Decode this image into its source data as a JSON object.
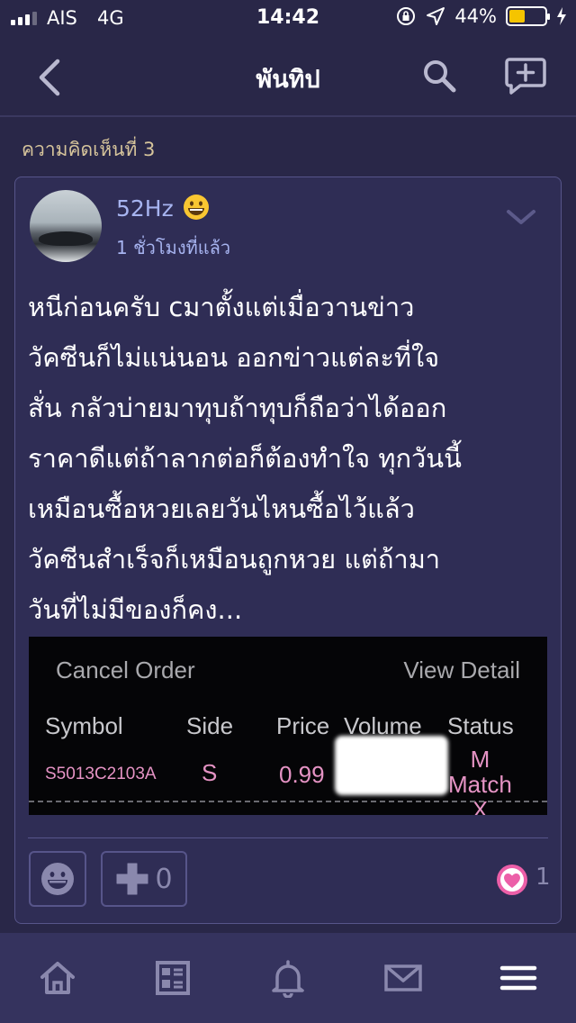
{
  "status_bar": {
    "carrier": "AIS",
    "network": "4G",
    "time": "14:42",
    "battery_percent": "44%",
    "battery_level": 0.44
  },
  "nav": {
    "title": "พันทิป",
    "icons": [
      "back-icon",
      "search-icon",
      "compose-icon"
    ]
  },
  "comment": {
    "number_label": "ความคิดเห็นที่ 3",
    "author": "52Hz",
    "time_ago": "1 ชั่วโมงที่แล้ว",
    "text": "หนีก่อนครับ cมาตั้งแต่เมื่อวานข่าว\nวัคซีนก็ไม่แน่นอน ออกข่าวแต่ละที่ใจ\nสั่น กลัวบ่ายมาทุบถ้าทุบก็ถือว่าได้ออก\nราคาดีแต่ถ้าลากต่อก็ต้องทำใจ ทุกวันนี้\nเหมือนซื้อหวยเลยวันไหนซื้อไว้แล้ว\nวัคซีนสำเร็จก็เหมือนถูกหวย แต่ถ้ามา\nวันที่ไม่มีของก็คง..."
  },
  "embedded_image": {
    "cancel_label": "Cancel Order",
    "view_label": "View Detail",
    "headers": [
      "Symbol",
      "Side",
      "Price",
      "Volume",
      "Status"
    ],
    "row": {
      "symbol": "S5013C2103A",
      "side": "S",
      "price": "0.99",
      "status_line1": "M",
      "status_line2": "Match",
      "status_line3": "X"
    }
  },
  "actions": {
    "plus_count": "0",
    "like_count": "1"
  },
  "colors": {
    "background": "#292748",
    "card": "#2f2d55",
    "accent_blue": "#a7b4f0",
    "comment_label": "#d6c49b",
    "heart": "#ec5fa8"
  },
  "tabbar": {
    "icons": [
      "home-icon",
      "feed-icon",
      "bell-icon",
      "mail-icon",
      "menu-icon"
    ]
  }
}
